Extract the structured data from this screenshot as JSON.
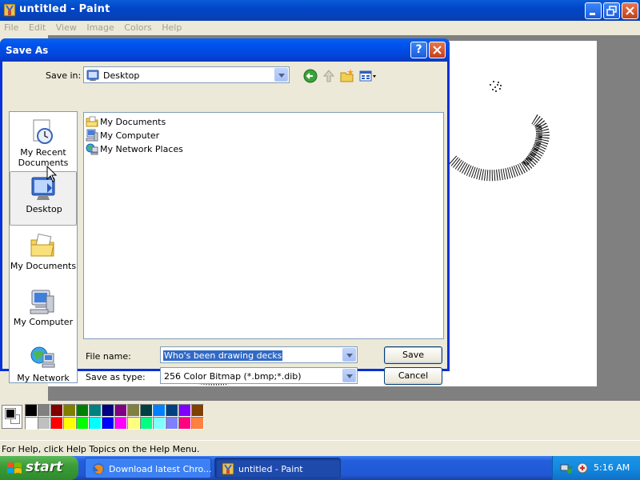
{
  "paint_window": {
    "title": "untitled - Paint",
    "menu": [
      "File",
      "Edit",
      "View",
      "Image",
      "Colors",
      "Help"
    ]
  },
  "palette": {
    "row1": [
      "#000000",
      "#808080",
      "#800000",
      "#808000",
      "#008000",
      "#008080",
      "#000080",
      "#800080",
      "#808040",
      "#004040",
      "#0080ff",
      "#004080",
      "#8000ff",
      "#804000"
    ],
    "row2": [
      "#ffffff",
      "#c0c0c0",
      "#ff0000",
      "#ffff00",
      "#00ff00",
      "#00ffff",
      "#0000ff",
      "#ff00ff",
      "#ffff80",
      "#00ff80",
      "#80ffff",
      "#8080ff",
      "#ff0080",
      "#ff8040"
    ]
  },
  "status_bar": {
    "text": "For Help, click Help Topics on the Help Menu."
  },
  "dialog": {
    "title": "Save As",
    "help_button": "?",
    "save_in_label": "Save in:",
    "save_in_value": "Desktop",
    "places": [
      {
        "label": "My Recent Documents",
        "icon": "recent-documents-icon"
      },
      {
        "label": "Desktop",
        "icon": "desktop-icon",
        "selected": true
      },
      {
        "label": "My Documents",
        "icon": "my-documents-icon"
      },
      {
        "label": "My Computer",
        "icon": "my-computer-icon"
      },
      {
        "label": "My Network",
        "icon": "my-network-icon"
      }
    ],
    "files": [
      {
        "label": "My Documents",
        "icon": "folder-icon"
      },
      {
        "label": "My Computer",
        "icon": "computer-icon"
      },
      {
        "label": "My Network Places",
        "icon": "network-places-icon"
      }
    ],
    "file_name_label": "File name:",
    "file_name_value": "Who's been drawing decks",
    "save_as_type_label": "Save as type:",
    "save_as_type_value": "256 Color Bitmap (*.bmp;*.dib)",
    "save_button": "Save",
    "cancel_button": "Cancel"
  },
  "taskbar": {
    "start_label": "start",
    "tasks": [
      {
        "label": "Download latest Chro...",
        "icon": "firefox-icon",
        "active": false
      },
      {
        "label": "untitled - Paint",
        "icon": "paint-icon",
        "active": true
      }
    ],
    "clock": "5:16 AM"
  }
}
